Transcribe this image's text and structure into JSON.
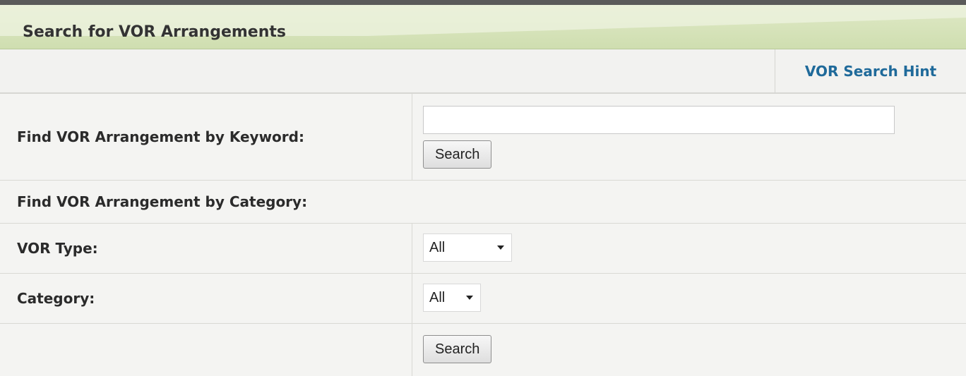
{
  "header": {
    "title": "Search for VOR Arrangements"
  },
  "hint": {
    "label": "VOR Search Hint"
  },
  "keyword": {
    "label": "Find VOR Arrangement by Keyword:",
    "value": "",
    "search_label": "Search"
  },
  "category_section": {
    "label": "Find VOR Arrangement by Category:"
  },
  "vor_type": {
    "label": "VOR Type:",
    "selected": "All"
  },
  "category": {
    "label": "Category:",
    "selected": "All"
  },
  "category_search": {
    "search_label": "Search"
  },
  "colors": {
    "header_green": "#cfdeb0",
    "link_blue": "#1f6a9a",
    "row_bg": "#f4f4f2"
  }
}
